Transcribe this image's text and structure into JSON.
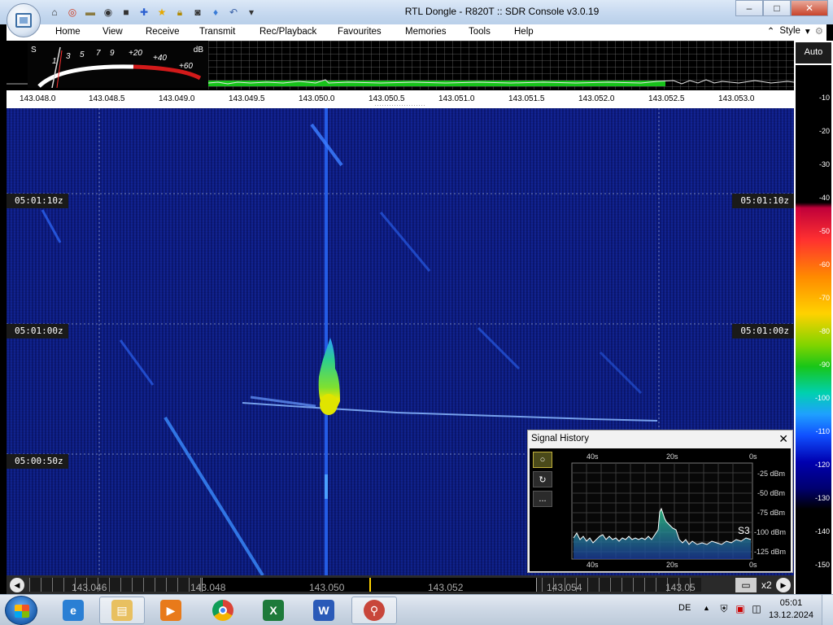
{
  "window": {
    "title": "RTL Dongle - R820T :: SDR Console v3.0.19",
    "controls": [
      "minimize",
      "maximize",
      "close"
    ]
  },
  "quick_access": [
    "home-icon",
    "lifebuoy-icon",
    "folder-icon",
    "record-icon",
    "stop-icon",
    "plus-icon",
    "star-icon",
    "lock-icon",
    "camera-icon",
    "drop-icon",
    "undo-icon",
    "dropdown-icon"
  ],
  "menu": {
    "items": [
      "Home",
      "View",
      "Receive",
      "Transmit",
      "Rec/Playback",
      "Favourites",
      "Memories",
      "Tools",
      "Help"
    ],
    "style_label": "Style"
  },
  "smeter": {
    "s_label": "S",
    "db_label": "dB",
    "s_ticks": [
      "1",
      "3",
      "5",
      "7",
      "9"
    ],
    "plus_ticks": [
      "+20",
      "+40",
      "+60"
    ]
  },
  "frequency_scale": {
    "ticks": [
      "143.048.0",
      "143.048.5",
      "143.049.0",
      "143.049.5",
      "143.050.0",
      "143.050.5",
      "143.051.0",
      "143.051.5",
      "143.052.0",
      "143.052.5",
      "143.053.0"
    ]
  },
  "waterfall": {
    "time_labels": [
      "05:01:10z",
      "05:01:00z",
      "05:00:50z"
    ]
  },
  "db_scale": {
    "auto_label": "Auto",
    "labels": [
      "-10",
      "-20",
      "-30",
      "-40",
      "-50",
      "-60",
      "-70",
      "-80",
      "-90",
      "-100",
      "-110",
      "-120",
      "-130",
      "-140",
      "-150"
    ]
  },
  "signal_history": {
    "title": "Signal History",
    "close": "✕",
    "time_axis": [
      "40s",
      "20s",
      "0s"
    ],
    "level_axis": [
      "-25 dBm",
      "-50 dBm",
      "-75 dBm",
      "-100 dBm",
      "-125 dBm"
    ],
    "s_reading": "S3",
    "buttons": [
      "circle-icon",
      "refresh-icon",
      "more-icon"
    ],
    "more_label": "..."
  },
  "bottom_bar": {
    "freqs": [
      "143.046",
      "143.048",
      "143.050",
      "143.052",
      "143.054",
      "143.05"
    ],
    "zoom_label": "x2"
  },
  "taskbar": {
    "apps": [
      "internet-explorer",
      "file-explorer",
      "media-player",
      "chrome",
      "excel",
      "word",
      "sdr-console"
    ],
    "language": "DE",
    "time": "05:01",
    "date": "13.12.2024"
  },
  "colors": {
    "waterfall_bg": "#0a1a80",
    "signal_core": "#e6e600",
    "signal_mid": "#39d43a",
    "accent_green": "#17c21a"
  }
}
